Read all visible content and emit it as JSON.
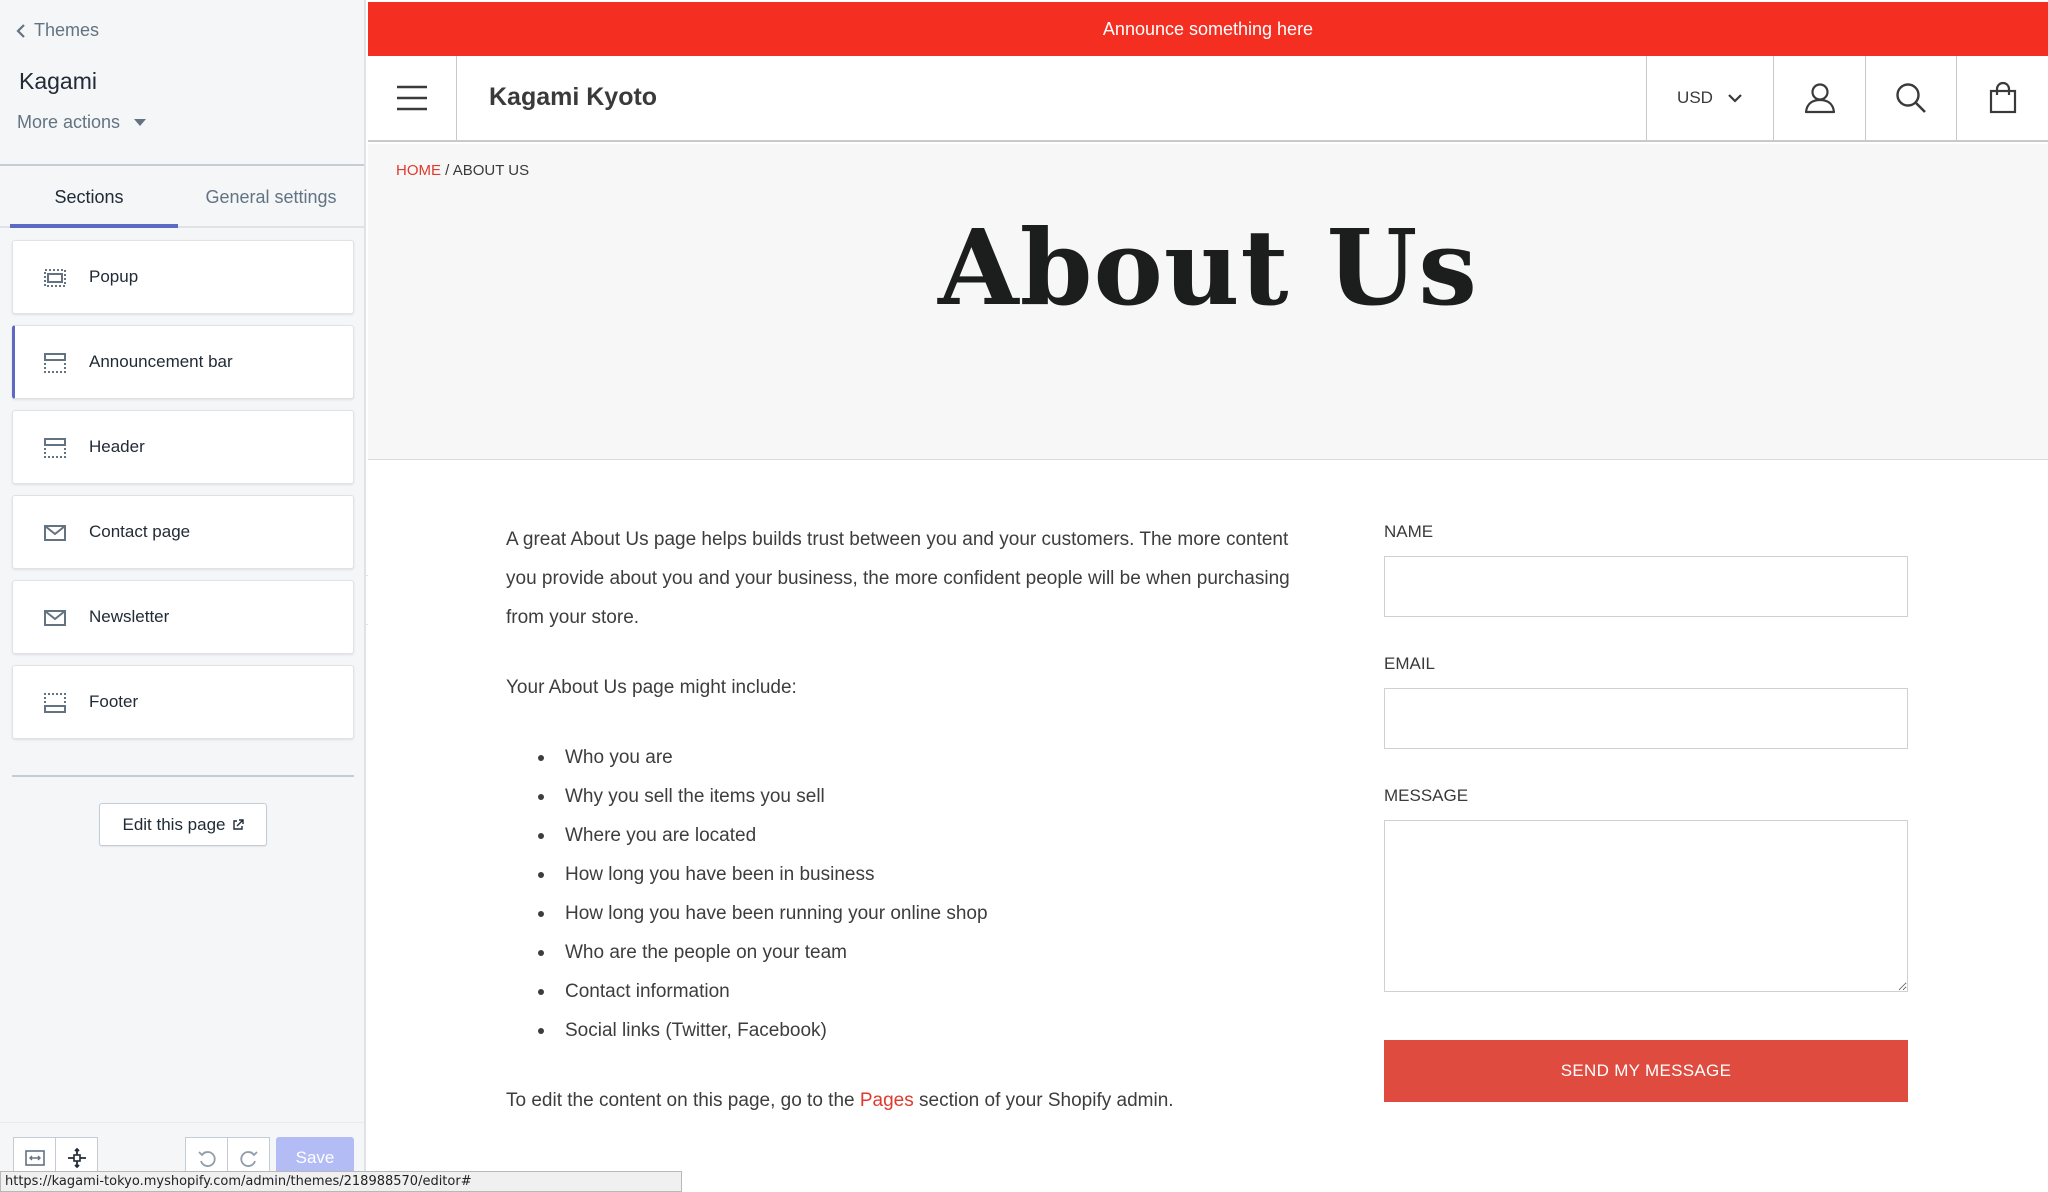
{
  "sidebar": {
    "back_label": "Themes",
    "theme_name": "Kagami",
    "more_actions_label": "More actions",
    "tabs": [
      {
        "label": "Sections",
        "active": true
      },
      {
        "label": "General settings",
        "active": false
      }
    ],
    "sections": [
      {
        "label": "Popup",
        "icon": "popup-section-icon"
      },
      {
        "label": "Announcement bar",
        "icon": "announcement-section-icon",
        "selected": true
      },
      {
        "label": "Header",
        "icon": "header-section-icon"
      },
      {
        "label": "Contact page",
        "icon": "envelope-icon"
      },
      {
        "label": "Newsletter",
        "icon": "envelope-icon"
      },
      {
        "label": "Footer",
        "icon": "footer-section-icon"
      }
    ],
    "edit_page_label": "Edit this page",
    "save_label": "Save",
    "accent_color": "#5c6ac4"
  },
  "status_url": "https://kagami-tokyo.myshopify.com/admin/themes/218988570/editor#",
  "preview": {
    "announcement": "Announce something here",
    "announcement_color": "#f42e21",
    "site_name": "Kagami Kyoto",
    "currency": "USD",
    "breadcrumb": {
      "home": "HOME",
      "separator": "/",
      "current": "ABOUT US"
    },
    "page_title": "About Us",
    "intro": "A great About Us page helps builds trust between you and your customers. The more content you provide about you and your business, the more confident people will be when purchasing from your store.",
    "list_intro": "Your About Us page might include:",
    "list_items": [
      "Who you are",
      "Why you sell the items you sell",
      "Where you are located",
      "How long you have been in business",
      "How long you have been running your online shop",
      "Who are the people on your team",
      "Contact information",
      "Social links (Twitter, Facebook)"
    ],
    "outro_before": "To edit the content on this page, go to the",
    "outro_link": "Pages",
    "outro_after": "section of your Shopify admin.",
    "form": {
      "name_label": "NAME",
      "name_value": "",
      "email_label": "EMAIL",
      "email_value": "",
      "message_label": "MESSAGE",
      "message_value": "",
      "submit_label": "SEND MY MESSAGE",
      "submit_color": "#df4b3f"
    }
  }
}
